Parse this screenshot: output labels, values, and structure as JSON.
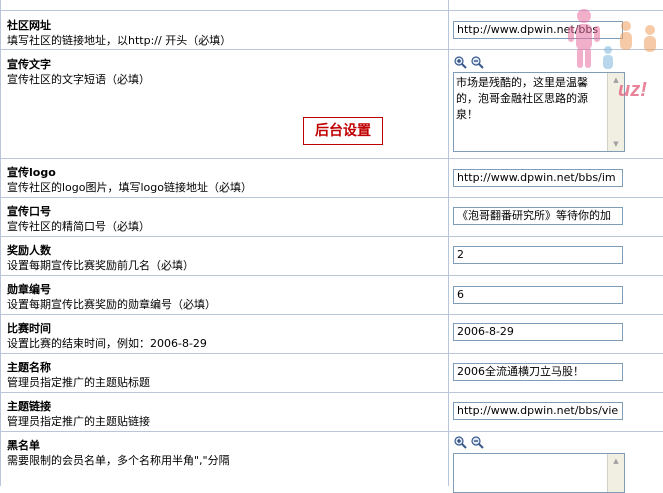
{
  "rows": {
    "community_url": {
      "title": "社区网址",
      "desc": "填写社区的链接地址，以http:// 开头（必填）",
      "value": "http://www.dpwin.net/bbs"
    },
    "promo_text": {
      "title": "宣传文字",
      "desc": "宣传社区的文字短语（必填）",
      "value": "市场是残酷的，这里是温馨的，泡哥金融社区思路的源泉！"
    },
    "promo_logo": {
      "title": "宣传logo",
      "desc": "宣传社区的logo图片，填写logo链接地址（必填）",
      "value": "http://www.dpwin.net/bbs/im"
    },
    "promo_slogan": {
      "title": "宣传口号",
      "desc": "宣传社区的精简口号（必填）",
      "value": "《泡哥翻番研究所》等待你的加"
    },
    "reward_count": {
      "title": "奖励人数",
      "desc": "设置每期宣传比赛奖励前几名（必填）",
      "value": "2"
    },
    "medal_id": {
      "title": "勋章编号",
      "desc": "设置每期宣传比赛奖励的勋章编号（必填）",
      "value": "6"
    },
    "contest_time": {
      "title": "比赛时间",
      "desc": "设置比赛的结束时间，例如：2006-8-29",
      "value": "2006-8-29"
    },
    "topic_name": {
      "title": "主题名称",
      "desc": "管理员指定推广的主题贴标题",
      "value": "2006全流通横刀立马股！"
    },
    "topic_link": {
      "title": "主题链接",
      "desc": "管理员指定推广的主题贴链接",
      "value": "http://www.dpwin.net/bbs/vie"
    },
    "blacklist": {
      "title": "黑名单",
      "desc": "需要限制的会员名单，多个名称用半角\",\"分隔",
      "value": ""
    }
  },
  "admin_badge": "后台设置",
  "watermark_text": "uz!",
  "colors": {
    "border": "#b9c6d9",
    "input_border": "#7f9db9",
    "badge": "#c00000"
  },
  "icons": [
    "zoom-in-icon",
    "zoom-out-icon",
    "scroll-up-icon",
    "scroll-down-icon"
  ]
}
